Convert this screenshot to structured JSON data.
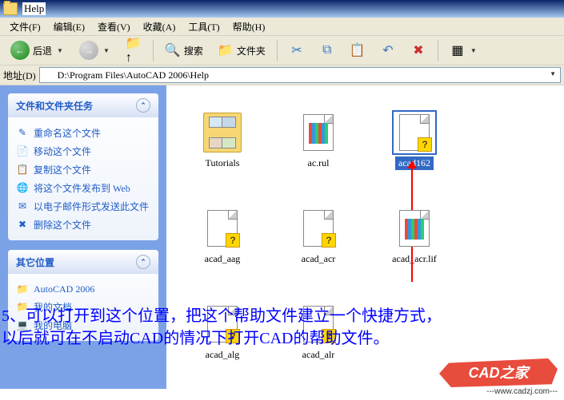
{
  "title": "Help",
  "menu": {
    "file": "文件(F)",
    "edit": "编辑(E)",
    "view": "查看(V)",
    "favorites": "收藏(A)",
    "tools": "工具(T)",
    "help": "帮助(H)"
  },
  "toolbar": {
    "back": "后退",
    "search": "搜索",
    "folders": "文件夹"
  },
  "address": {
    "label": "地址(D)",
    "path": "D:\\Program Files\\AutoCAD 2006\\Help"
  },
  "panels": {
    "tasks_title": "文件和文件夹任务",
    "tasks": [
      {
        "icon": "✎",
        "label": "重命名这个文件"
      },
      {
        "icon": "📄",
        "label": "移动这个文件"
      },
      {
        "icon": "📋",
        "label": "复制这个文件"
      },
      {
        "icon": "🌐",
        "label": "将这个文件发布到 Web"
      },
      {
        "icon": "✉",
        "label": "以电子邮件形式发送此文件"
      },
      {
        "icon": "✖",
        "label": "删除这个文件"
      }
    ],
    "places_title": "其它位置",
    "places": [
      {
        "icon": "📁",
        "label": "AutoCAD 2006"
      },
      {
        "icon": "📁",
        "label": "我的文档"
      },
      {
        "icon": "💻",
        "label": "我的电脑"
      }
    ]
  },
  "files": [
    {
      "name": "Tutorials",
      "type": "folder"
    },
    {
      "name": "ac.rul",
      "type": "grid"
    },
    {
      "name": "acad162",
      "type": "help",
      "selected": true
    },
    {
      "name": "acad_aag",
      "type": "help"
    },
    {
      "name": "acad_acr",
      "type": "help"
    },
    {
      "name": "acad_acr.lif",
      "type": "grid"
    },
    {
      "name": "acad_alg",
      "type": "help"
    },
    {
      "name": "acad_alr",
      "type": "help"
    }
  ],
  "caption_line1": "5、可以打开到这个位置，把这个帮助文件建立一个快捷方式，",
  "caption_line2": "以后就可在不启动CAD的情况下打开CAD的帮助文件。",
  "logo_text": "CAD之家",
  "logo_url": "---www.cadzj.com---"
}
